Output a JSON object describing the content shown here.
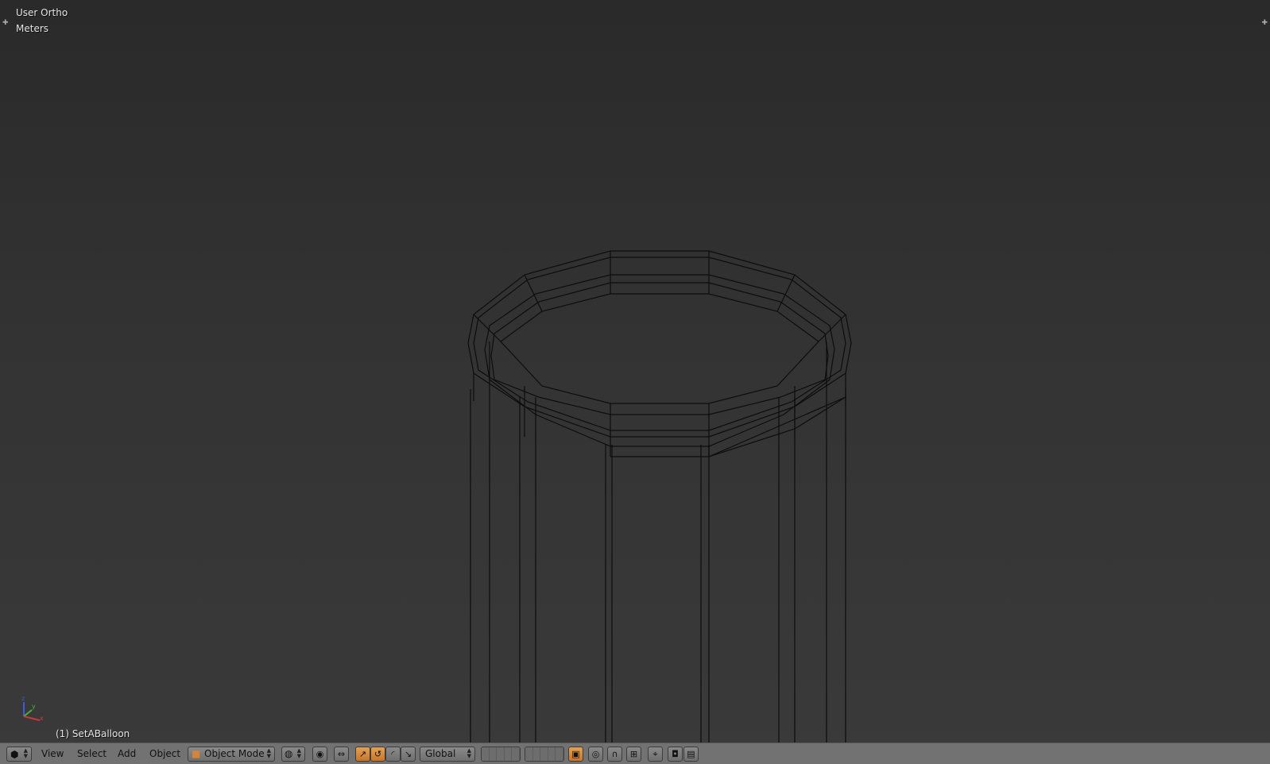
{
  "viewport": {
    "view_name": "User Ortho",
    "units": "Meters",
    "active_object": "(1) SetABalloon"
  },
  "header": {
    "menus": [
      "View",
      "Select",
      "Add",
      "Object"
    ],
    "mode_selector": "Object Mode",
    "transform_orientation": "Global"
  },
  "colors": {
    "accent": "#d5853a",
    "header_bg": "#727272"
  }
}
